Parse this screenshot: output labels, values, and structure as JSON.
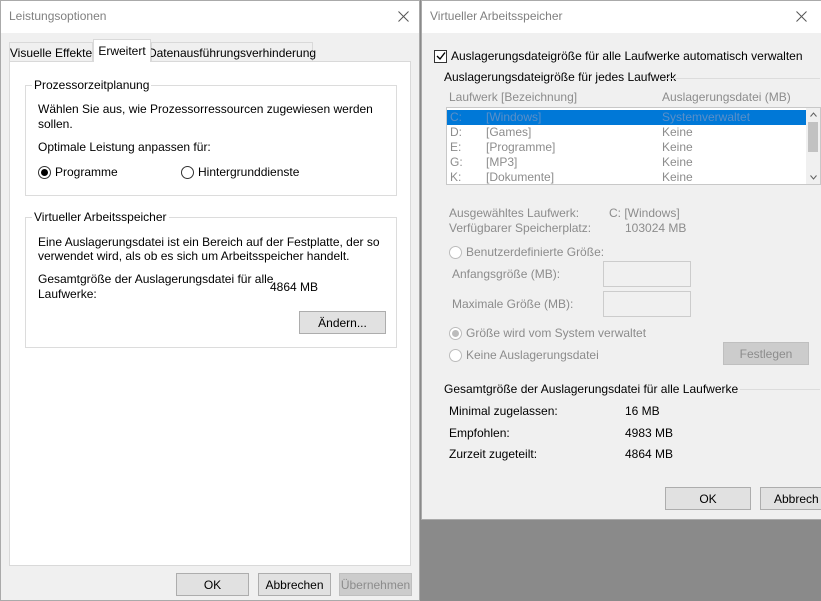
{
  "perf_window": {
    "title": "Leistungsoptionen",
    "tabs": [
      "Visuelle Effekte",
      "Erweitert",
      "Datenausführungsverhinderung"
    ],
    "active_tab": "Erweitert",
    "cpu_group": {
      "title": "Prozessorzeitplanung",
      "desc_line1": "Wählen Sie aus, wie Prozessorressourcen zugewiesen werden",
      "desc_line2": "sollen.",
      "adjust_label": "Optimale Leistung anpassen für:",
      "opt_programs": "Programme",
      "opt_background": "Hintergrunddienste"
    },
    "vm_group": {
      "title": "Virtueller Arbeitsspeicher",
      "desc_line1": "Eine Auslagerungsdatei ist ein Bereich auf der Festplatte, der so",
      "desc_line2": "verwendet wird, als ob es sich um Arbeitsspeicher handelt.",
      "total_line1": "Gesamtgröße der Auslagerungsdatei für alle",
      "total_line2": "Laufwerke:",
      "total_value": "4864 MB",
      "change_button": "Ändern..."
    },
    "buttons": {
      "ok": "OK",
      "cancel": "Abbrechen",
      "apply": "Übernehmen"
    }
  },
  "vm_window": {
    "title": "Virtueller Arbeitsspeicher",
    "auto_manage_label": "Auslagerungsdateigröße für alle Laufwerke automatisch verwalten",
    "auto_manage_checked": true,
    "per_drive_title": "Auslagerungsdateigröße für jedes Laufwerk",
    "columns": {
      "drive": "Laufwerk [Bezeichnung]",
      "pagefile": "Auslagerungsdatei (MB)"
    },
    "drives": [
      {
        "letter": "C:",
        "label": "[Windows]",
        "pagefile": "Systemverwaltet",
        "selected": true
      },
      {
        "letter": "D:",
        "label": "[Games]",
        "pagefile": "Keine",
        "selected": false
      },
      {
        "letter": "E:",
        "label": "[Programme]",
        "pagefile": "Keine",
        "selected": false
      },
      {
        "letter": "G:",
        "label": "[MP3]",
        "pagefile": "Keine",
        "selected": false
      },
      {
        "letter": "K:",
        "label": "[Dokumente]",
        "pagefile": "Keine",
        "selected": false
      }
    ],
    "selected_drive_label": "Ausgewähltes Laufwerk:",
    "selected_drive_value": "C:  [Windows]",
    "free_space_label": "Verfügbarer Speicherplatz:",
    "free_space_value": "103024 MB",
    "custom_size_label": "Benutzerdefinierte Größe:",
    "initial_size_label": "Anfangsgröße (MB):",
    "max_size_label": "Maximale Größe (MB):",
    "system_managed_label": "Größe wird vom System verwaltet",
    "no_pagefile_label": "Keine Auslagerungsdatei",
    "set_button": "Festlegen",
    "totals_title": "Gesamtgröße der Auslagerungsdatei für alle Laufwerke",
    "min_allowed_label": "Minimal zugelassen:",
    "min_allowed_value": "16 MB",
    "recommended_label": "Empfohlen:",
    "recommended_value": "4983 MB",
    "allocated_label": "Zurzeit zugeteilt:",
    "allocated_value": "4864 MB",
    "buttons": {
      "ok": "OK",
      "cancel": "Abbrech"
    }
  }
}
